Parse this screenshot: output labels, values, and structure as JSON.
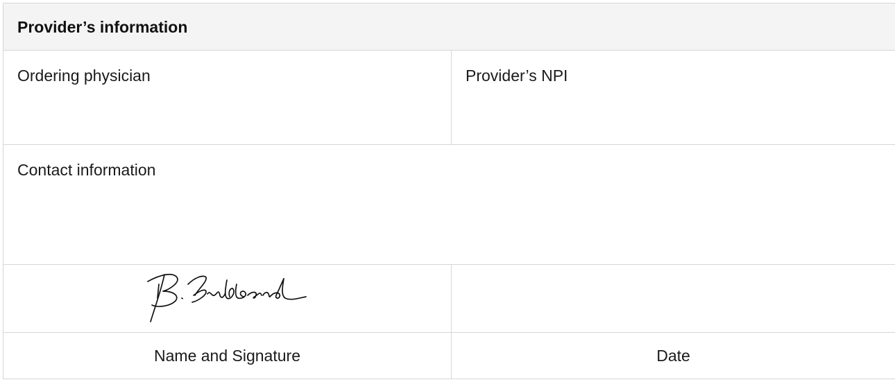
{
  "section": {
    "title": "Provider’s information"
  },
  "fields": {
    "ordering_physician_label": "Ordering physician",
    "provider_npi_label": "Provider’s NPI",
    "contact_information_label": "Contact information"
  },
  "signature_block": {
    "signature_text": "B. Hubbard",
    "name_and_signature_label": "Name and Signature",
    "date_label": "Date"
  }
}
